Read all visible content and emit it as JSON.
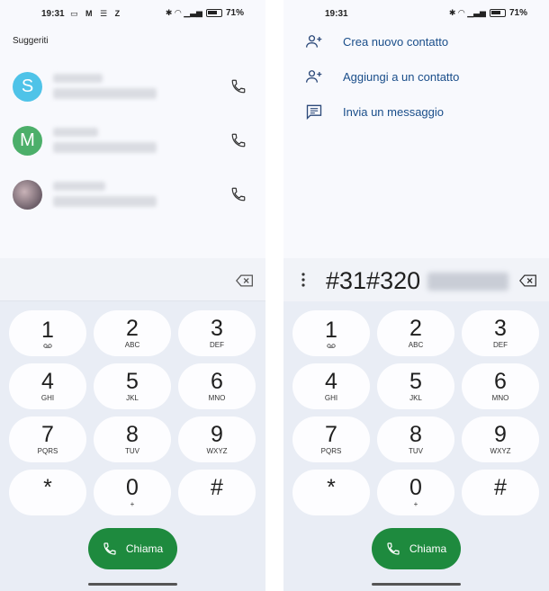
{
  "status": {
    "time": "19:31",
    "battery": "71%"
  },
  "left": {
    "suggested_title": "Suggeriti",
    "contacts": [
      {
        "initial": "S",
        "color": "#4fc3e8"
      },
      {
        "initial": "M",
        "color": "#4caf6a"
      },
      {
        "initial": "",
        "color": "#8a7f86"
      }
    ]
  },
  "right": {
    "menu": [
      {
        "label": "Crea nuovo contatto",
        "icon": "add-person-icon"
      },
      {
        "label": "Aggiungi a un contatto",
        "icon": "add-person-icon"
      },
      {
        "label": "Invia un messaggio",
        "icon": "message-icon"
      }
    ],
    "number": "#31#320"
  },
  "keypad": [
    {
      "digit": "1",
      "letters": ""
    },
    {
      "digit": "2",
      "letters": "ABC"
    },
    {
      "digit": "3",
      "letters": "DEF"
    },
    {
      "digit": "4",
      "letters": "GHI"
    },
    {
      "digit": "5",
      "letters": "JKL"
    },
    {
      "digit": "6",
      "letters": "MNO"
    },
    {
      "digit": "7",
      "letters": "PQRS"
    },
    {
      "digit": "8",
      "letters": "TUV"
    },
    {
      "digit": "9",
      "letters": "WXYZ"
    },
    {
      "digit": "*",
      "letters": ""
    },
    {
      "digit": "0",
      "letters": "+"
    },
    {
      "digit": "#",
      "letters": ""
    }
  ],
  "call_label": "Chiama",
  "colors": {
    "call": "#1e8a3e",
    "link": "#1a4e8a"
  }
}
